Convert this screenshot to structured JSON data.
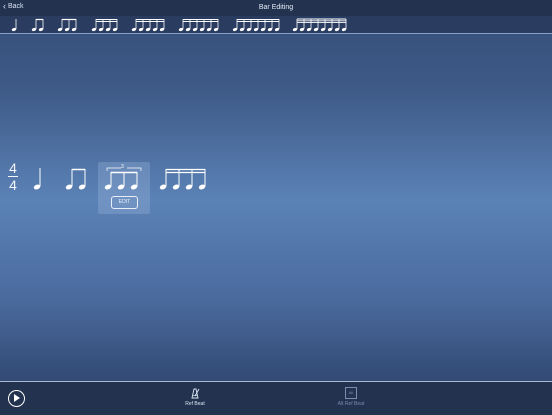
{
  "header": {
    "back_label": "Back",
    "title": "Bar Editing"
  },
  "palette": {
    "items": [
      "quarter-note",
      "eighth-pair",
      "eighth-triplet",
      "sixteenth-quad",
      "quintuplet",
      "sextuplet",
      "septuplet",
      "octuplet"
    ]
  },
  "bar": {
    "time_signature": {
      "top": "4",
      "bottom": "4"
    },
    "beats": [
      {
        "type": "quarter-note"
      },
      {
        "type": "eighth-pair"
      },
      {
        "type": "triplet",
        "tuplet_label": "3",
        "selected": true
      },
      {
        "type": "sixteenth-quad"
      }
    ],
    "edit_label": "EDIT"
  },
  "toolbar": {
    "play_icon": "play-icon",
    "ref_beat_label": "Ref Beat",
    "alt_ref_beat_label": "Alt Ref Beat",
    "alt_ref_beat_icon_text": "Alt"
  },
  "colors": {
    "topbar": "#22324f",
    "palette": "#2a3d61",
    "accent": "#ffffff"
  }
}
